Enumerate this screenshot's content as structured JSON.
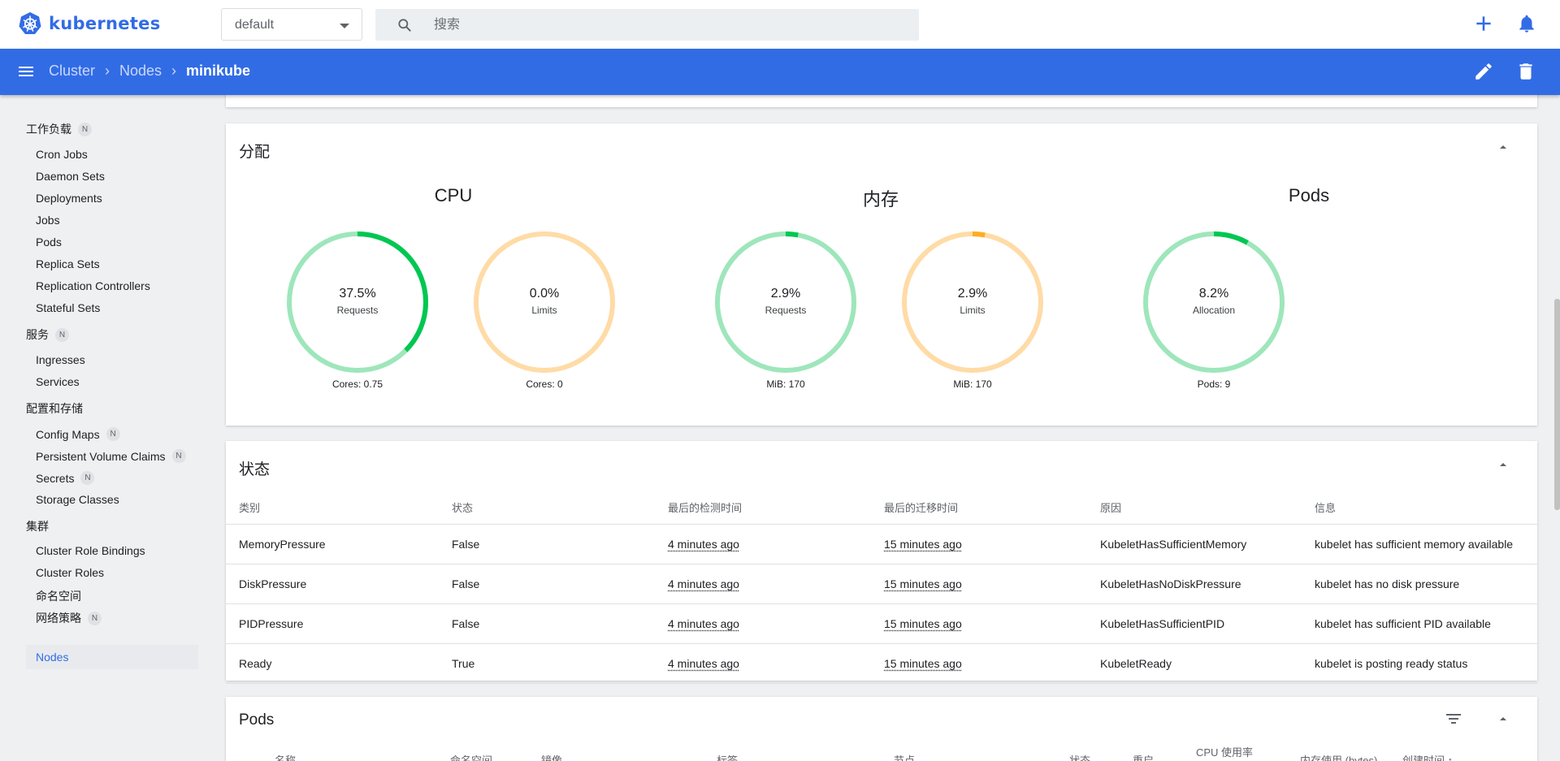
{
  "topbar": {
    "brand": "kubernetes",
    "namespace": "default",
    "search_placeholder": "搜索"
  },
  "appbar": {
    "breadcrumbs": [
      "Cluster",
      "Nodes",
      "minikube"
    ]
  },
  "sidebar": {
    "sections": [
      {
        "label": "工作负载",
        "badge": "N",
        "items": [
          {
            "label": "Cron Jobs"
          },
          {
            "label": "Daemon Sets"
          },
          {
            "label": "Deployments"
          },
          {
            "label": "Jobs"
          },
          {
            "label": "Pods"
          },
          {
            "label": "Replica Sets"
          },
          {
            "label": "Replication Controllers"
          },
          {
            "label": "Stateful Sets"
          }
        ]
      },
      {
        "label": "服务",
        "badge": "N",
        "items": [
          {
            "label": "Ingresses"
          },
          {
            "label": "Services"
          }
        ]
      },
      {
        "label": "配置和存储",
        "badge": "",
        "items": [
          {
            "label": "Config Maps",
            "badge": "N"
          },
          {
            "label": "Persistent Volume Claims",
            "badge": "N"
          },
          {
            "label": "Secrets",
            "badge": "N"
          },
          {
            "label": "Storage Classes"
          }
        ]
      },
      {
        "label": "集群",
        "badge": "",
        "items": [
          {
            "label": "Cluster Role Bindings"
          },
          {
            "label": "Cluster Roles"
          },
          {
            "label": "命名空间"
          },
          {
            "label": "网络策略",
            "badge": "N"
          },
          {
            "label": "Nodes",
            "active": true
          }
        ]
      }
    ]
  },
  "allocation": {
    "title": "分配",
    "groups": [
      {
        "title": "CPU",
        "charts": [
          {
            "percent": "37.5%",
            "label": "Requests",
            "caption": "Cores: 0.75",
            "value": 0.375,
            "color": "#00c752",
            "track": "#9ee6bb"
          },
          {
            "percent": "0.0%",
            "label": "Limits",
            "caption": "Cores: 0",
            "value": 0.0,
            "color": "#ffad20",
            "track": "#ffdba6"
          }
        ]
      },
      {
        "title": "内存",
        "charts": [
          {
            "percent": "2.9%",
            "label": "Requests",
            "caption": "MiB: 170",
            "value": 0.029,
            "color": "#00c752",
            "track": "#9ee6bb"
          },
          {
            "percent": "2.9%",
            "label": "Limits",
            "caption": "MiB: 170",
            "value": 0.029,
            "color": "#ffad20",
            "track": "#ffdba6"
          }
        ]
      },
      {
        "title": "Pods",
        "charts": [
          {
            "percent": "8.2%",
            "label": "Allocation",
            "caption": "Pods: 9",
            "value": 0.082,
            "color": "#00c752",
            "track": "#9ee6bb"
          }
        ]
      }
    ]
  },
  "conditions": {
    "title": "状态",
    "columns": [
      "类别",
      "状态",
      "最后的检测时间",
      "最后的迁移时间",
      "原因",
      "信息"
    ],
    "rows": [
      {
        "type": "MemoryPressure",
        "status": "False",
        "probe": "4 minutes ago",
        "transition": "15 minutes ago",
        "reason": "KubeletHasSufficientMemory",
        "message": "kubelet has sufficient memory available"
      },
      {
        "type": "DiskPressure",
        "status": "False",
        "probe": "4 minutes ago",
        "transition": "15 minutes ago",
        "reason": "KubeletHasNoDiskPressure",
        "message": "kubelet has no disk pressure"
      },
      {
        "type": "PIDPressure",
        "status": "False",
        "probe": "4 minutes ago",
        "transition": "15 minutes ago",
        "reason": "KubeletHasSufficientPID",
        "message": "kubelet has sufficient PID available"
      },
      {
        "type": "Ready",
        "status": "True",
        "probe": "4 minutes ago",
        "transition": "15 minutes ago",
        "reason": "KubeletReady",
        "message": "kubelet is posting ready status"
      }
    ]
  },
  "pods": {
    "title": "Pods",
    "columns": [
      "名称",
      "命名空间",
      "镜像",
      "标签",
      "节点",
      "状态",
      "重启",
      "CPU 使用率",
      "内存使用 (bytes)",
      "创建时间 ↑"
    ]
  }
}
